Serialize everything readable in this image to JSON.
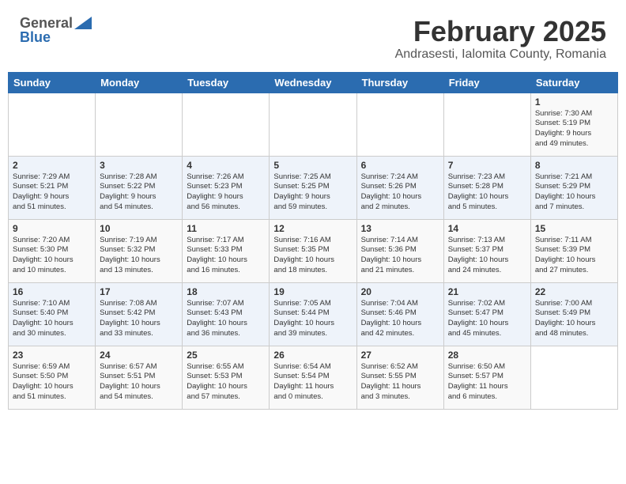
{
  "header": {
    "logo_general": "General",
    "logo_blue": "Blue",
    "month_title": "February 2025",
    "location": "Andrasesti, Ialomita County, Romania"
  },
  "weekdays": [
    "Sunday",
    "Monday",
    "Tuesday",
    "Wednesday",
    "Thursday",
    "Friday",
    "Saturday"
  ],
  "weeks": [
    [
      {
        "day": "",
        "info": ""
      },
      {
        "day": "",
        "info": ""
      },
      {
        "day": "",
        "info": ""
      },
      {
        "day": "",
        "info": ""
      },
      {
        "day": "",
        "info": ""
      },
      {
        "day": "",
        "info": ""
      },
      {
        "day": "1",
        "info": "Sunrise: 7:30 AM\nSunset: 5:19 PM\nDaylight: 9 hours\nand 49 minutes."
      }
    ],
    [
      {
        "day": "2",
        "info": "Sunrise: 7:29 AM\nSunset: 5:21 PM\nDaylight: 9 hours\nand 51 minutes."
      },
      {
        "day": "3",
        "info": "Sunrise: 7:28 AM\nSunset: 5:22 PM\nDaylight: 9 hours\nand 54 minutes."
      },
      {
        "day": "4",
        "info": "Sunrise: 7:26 AM\nSunset: 5:23 PM\nDaylight: 9 hours\nand 56 minutes."
      },
      {
        "day": "5",
        "info": "Sunrise: 7:25 AM\nSunset: 5:25 PM\nDaylight: 9 hours\nand 59 minutes."
      },
      {
        "day": "6",
        "info": "Sunrise: 7:24 AM\nSunset: 5:26 PM\nDaylight: 10 hours\nand 2 minutes."
      },
      {
        "day": "7",
        "info": "Sunrise: 7:23 AM\nSunset: 5:28 PM\nDaylight: 10 hours\nand 5 minutes."
      },
      {
        "day": "8",
        "info": "Sunrise: 7:21 AM\nSunset: 5:29 PM\nDaylight: 10 hours\nand 7 minutes."
      }
    ],
    [
      {
        "day": "9",
        "info": "Sunrise: 7:20 AM\nSunset: 5:30 PM\nDaylight: 10 hours\nand 10 minutes."
      },
      {
        "day": "10",
        "info": "Sunrise: 7:19 AM\nSunset: 5:32 PM\nDaylight: 10 hours\nand 13 minutes."
      },
      {
        "day": "11",
        "info": "Sunrise: 7:17 AM\nSunset: 5:33 PM\nDaylight: 10 hours\nand 16 minutes."
      },
      {
        "day": "12",
        "info": "Sunrise: 7:16 AM\nSunset: 5:35 PM\nDaylight: 10 hours\nand 18 minutes."
      },
      {
        "day": "13",
        "info": "Sunrise: 7:14 AM\nSunset: 5:36 PM\nDaylight: 10 hours\nand 21 minutes."
      },
      {
        "day": "14",
        "info": "Sunrise: 7:13 AM\nSunset: 5:37 PM\nDaylight: 10 hours\nand 24 minutes."
      },
      {
        "day": "15",
        "info": "Sunrise: 7:11 AM\nSunset: 5:39 PM\nDaylight: 10 hours\nand 27 minutes."
      }
    ],
    [
      {
        "day": "16",
        "info": "Sunrise: 7:10 AM\nSunset: 5:40 PM\nDaylight: 10 hours\nand 30 minutes."
      },
      {
        "day": "17",
        "info": "Sunrise: 7:08 AM\nSunset: 5:42 PM\nDaylight: 10 hours\nand 33 minutes."
      },
      {
        "day": "18",
        "info": "Sunrise: 7:07 AM\nSunset: 5:43 PM\nDaylight: 10 hours\nand 36 minutes."
      },
      {
        "day": "19",
        "info": "Sunrise: 7:05 AM\nSunset: 5:44 PM\nDaylight: 10 hours\nand 39 minutes."
      },
      {
        "day": "20",
        "info": "Sunrise: 7:04 AM\nSunset: 5:46 PM\nDaylight: 10 hours\nand 42 minutes."
      },
      {
        "day": "21",
        "info": "Sunrise: 7:02 AM\nSunset: 5:47 PM\nDaylight: 10 hours\nand 45 minutes."
      },
      {
        "day": "22",
        "info": "Sunrise: 7:00 AM\nSunset: 5:49 PM\nDaylight: 10 hours\nand 48 minutes."
      }
    ],
    [
      {
        "day": "23",
        "info": "Sunrise: 6:59 AM\nSunset: 5:50 PM\nDaylight: 10 hours\nand 51 minutes."
      },
      {
        "day": "24",
        "info": "Sunrise: 6:57 AM\nSunset: 5:51 PM\nDaylight: 10 hours\nand 54 minutes."
      },
      {
        "day": "25",
        "info": "Sunrise: 6:55 AM\nSunset: 5:53 PM\nDaylight: 10 hours\nand 57 minutes."
      },
      {
        "day": "26",
        "info": "Sunrise: 6:54 AM\nSunset: 5:54 PM\nDaylight: 11 hours\nand 0 minutes."
      },
      {
        "day": "27",
        "info": "Sunrise: 6:52 AM\nSunset: 5:55 PM\nDaylight: 11 hours\nand 3 minutes."
      },
      {
        "day": "28",
        "info": "Sunrise: 6:50 AM\nSunset: 5:57 PM\nDaylight: 11 hours\nand 6 minutes."
      },
      {
        "day": "",
        "info": ""
      }
    ]
  ]
}
